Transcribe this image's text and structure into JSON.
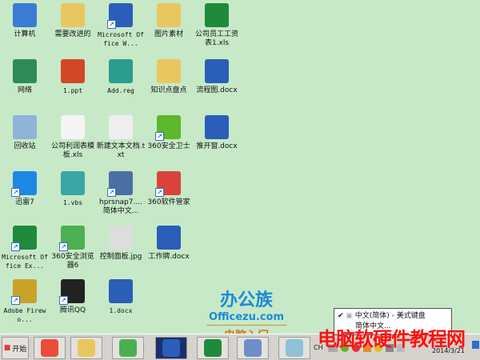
{
  "desktop": {
    "icons": [
      {
        "label": "计算机",
        "icon": "computer-icon",
        "color": "#3a7bd5",
        "col": 0,
        "row": 0
      },
      {
        "label": "需要改进的",
        "icon": "folder-icon",
        "color": "#e8c760",
        "col": 1,
        "row": 0
      },
      {
        "label": "Microsoft Office W...",
        "icon": "word-icon",
        "color": "#2b5eb8",
        "col": 2,
        "row": 0,
        "mono": true,
        "shortcut": true
      },
      {
        "label": "图片素材",
        "icon": "folder-icon",
        "color": "#e8c760",
        "col": 3,
        "row": 0
      },
      {
        "label": "公司员工工资表1.xls",
        "icon": "excel-icon",
        "color": "#1f8a3b",
        "col": 4,
        "row": 0
      },
      {
        "label": "网络",
        "icon": "network-icon",
        "color": "#2e8b57",
        "col": 0,
        "row": 1
      },
      {
        "label": "1.ppt",
        "icon": "powerpoint-icon",
        "color": "#d24726",
        "col": 1,
        "row": 1,
        "mono": true
      },
      {
        "label": "Add.reg",
        "icon": "registry-icon",
        "color": "#2a9d8f",
        "col": 2,
        "row": 1,
        "mono": true
      },
      {
        "label": "知识点盘点",
        "icon": "folder-icon",
        "color": "#e8c760",
        "col": 3,
        "row": 1
      },
      {
        "label": "流程图.docx",
        "icon": "word-doc-icon",
        "color": "#2b5eb8",
        "col": 4,
        "row": 1
      },
      {
        "label": "回收站",
        "icon": "recycle-bin-icon",
        "color": "#8fb3d9",
        "col": 0,
        "row": 2
      },
      {
        "label": "公司利润表模板.xls",
        "icon": "excel-file-icon",
        "color": "#f4f4f4",
        "col": 1,
        "row": 2
      },
      {
        "label": "新建文本文档.txt",
        "icon": "text-file-icon",
        "color": "#eeeeee",
        "col": 2,
        "row": 2
      },
      {
        "label": "360安全卫士",
        "icon": "360-safe-icon",
        "color": "#5cb82c",
        "col": 3,
        "row": 2,
        "shortcut": true
      },
      {
        "label": "推开窗.docx",
        "icon": "word-doc-icon",
        "color": "#2b5eb8",
        "col": 4,
        "row": 2
      },
      {
        "label": "迅雷7",
        "icon": "thunder-icon",
        "color": "#1e88e5",
        "col": 0,
        "row": 3,
        "shortcut": true
      },
      {
        "label": "1.vbs",
        "icon": "script-icon",
        "color": "#3aa6a6",
        "col": 1,
        "row": 3,
        "mono": true
      },
      {
        "label": "hprsnap7.... 简体中文...",
        "icon": "hypersnap-icon",
        "color": "#4a6fa5",
        "col": 2,
        "row": 3,
        "shortcut": true
      },
      {
        "label": "360软件管家",
        "icon": "360-manager-icon",
        "color": "#d9443a",
        "col": 3,
        "row": 3,
        "shortcut": true
      },
      {
        "label": "Microsoft Office Ex...",
        "icon": "excel-icon",
        "color": "#1f8a3b",
        "col": 0,
        "row": 4,
        "mono": true,
        "shortcut": true
      },
      {
        "label": "360安全浏览器6",
        "icon": "360-browser-icon",
        "color": "#4caf50",
        "col": 1,
        "row": 4,
        "shortcut": true
      },
      {
        "label": "控制面板.jpg",
        "icon": "image-file-icon",
        "color": "#dddddd",
        "col": 2,
        "row": 4
      },
      {
        "label": "工作牌.docx",
        "icon": "word-doc-icon",
        "color": "#2b5eb8",
        "col": 3,
        "row": 4
      },
      {
        "label": "Adobe Firewo...",
        "icon": "fireworks-icon",
        "color": "#c9a227",
        "col": 0,
        "row": 5,
        "mono": true,
        "shortcut": true
      },
      {
        "label": "腾讯QQ",
        "icon": "qq-icon",
        "color": "#222222",
        "col": 1,
        "row": 5,
        "shortcut": true
      },
      {
        "label": "1.docx",
        "icon": "word-doc-icon",
        "color": "#2b5eb8",
        "col": 2,
        "row": 5,
        "mono": true
      }
    ]
  },
  "logo": {
    "cn": "办公族",
    "site": "Officezu.com",
    "sub": "电脑入门"
  },
  "taskbar": {
    "start_label": "开始",
    "lang": "CH",
    "clock": "2014/3/21",
    "buttons": [
      {
        "icon": "360-app-icon",
        "color": "#e94e3c"
      },
      {
        "icon": "folder-icon",
        "color": "#e8c760"
      },
      {
        "icon": "ie-browser-icon",
        "color": "#4caf50"
      },
      {
        "icon": "word-icon",
        "color": "#2b5eb8",
        "active": true
      },
      {
        "icon": "excel-icon",
        "color": "#1f8a3b"
      },
      {
        "icon": "word-doc-icon",
        "color": "#6d8fc7"
      },
      {
        "icon": "notepad-icon",
        "color": "#8fc1d9"
      }
    ]
  },
  "ime_menu": {
    "items": [
      "中文(简体) - 美式键盘",
      "简体中文..."
    ],
    "checked": 0
  },
  "watermark": "电脑软硬件教程网"
}
